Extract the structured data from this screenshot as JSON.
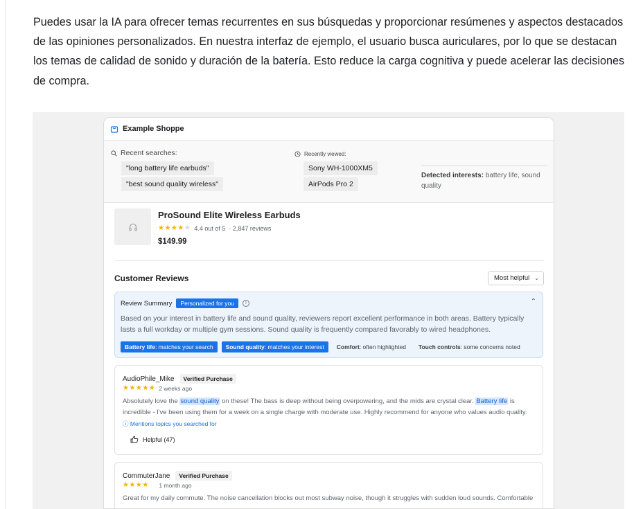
{
  "intro": "Puedes usar la IA para ofrecer temas recurrentes en sus búsquedas y proporcionar resúmenes y aspectos destacados de las opiniones personalizados. En nuestra interfaz de ejemplo, el usuario busca auriculares, por lo que se destacan los temas de calidad de sonido y duración de la batería. Esto reduce la carga cognitiva y puede acelerar las decisiones de compra.",
  "shop": {
    "name": "Example Shoppe",
    "accent": "#1a73e8"
  },
  "recent": {
    "searches_label": "Recent searches:",
    "searches": [
      "\"long battery life earbuds\"",
      "\"best sound quality wireless\""
    ],
    "viewed_label": "Recently viewed:",
    "viewed": [
      "Sony WH-1000XM5",
      "AirPods Pro 2"
    ],
    "detected_label": "Detected interests:",
    "detected_value": "battery life, sound quality"
  },
  "product": {
    "name": "ProSound Elite Wireless Earbuds",
    "rating": 4.4,
    "rating_text": "4.4 out of 5",
    "reviews": "· 2,847 reviews",
    "price": "$149.99",
    "icon": "headphones-icon"
  },
  "reviews_section": {
    "title": "Customer Reviews",
    "sort_value": "Most helpful"
  },
  "summary": {
    "title": "Review Summary",
    "badge": "Personalized for you",
    "body": "Based on your interest in battery life and sound quality, reviewers report excellent performance in both areas. Battery typically lasts a full workday or multiple gym sessions. Sound quality is frequently compared favorably to wired headphones.",
    "tags": [
      {
        "strong": "Battery life",
        "rest": ": matches your search",
        "style": "blue"
      },
      {
        "strong": "Sound quality",
        "rest": ": matches your interest",
        "style": "blue"
      },
      {
        "strong": "Comfort",
        "rest": ": often highlighted",
        "style": "grey"
      },
      {
        "strong": "Touch controls",
        "rest": ": some concerns noted",
        "style": "grey"
      }
    ]
  },
  "reviews": [
    {
      "author": "AudioPhile_Mike",
      "badge": "Verified Purchase",
      "stars": 5,
      "date": "2 weeks ago",
      "text_a": "Absolutely love the ",
      "hl_1": "sound quality",
      "text_b": " on these! The bass is deep without being overpowering, and the mids are crystal clear. ",
      "hl_2": "Battery life",
      "text_c": " is incredible - I've been using them for a week on a single charge with moderate use. Highly recommend for anyone who values audio quality.",
      "mentions": "ⓘ Mentions topics you searched for",
      "helpful": "Helpful (47)"
    },
    {
      "author": "CommuterJane",
      "badge": "Verified Purchase",
      "stars": 4,
      "date": "1 month ago",
      "text": "Great for my daily commute. The noise cancellation blocks out most subway noise, though it struggles with sudden loud sounds. Comfortable"
    }
  ]
}
